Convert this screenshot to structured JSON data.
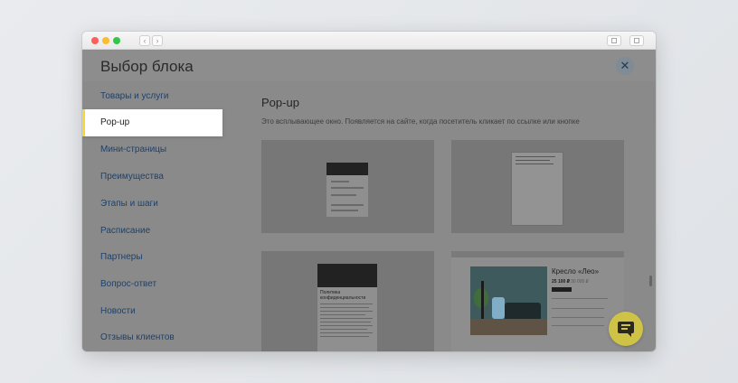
{
  "window": {
    "back": "‹",
    "forward": "›"
  },
  "header": {
    "title": "Выбор блока",
    "close": "✕"
  },
  "sidebar": {
    "items": [
      {
        "label": "Товары и услуги"
      },
      {
        "label": "Pop-up"
      },
      {
        "label": "Мини-страницы"
      },
      {
        "label": "Преимущества"
      },
      {
        "label": "Этапы и шаги"
      },
      {
        "label": "Расписание"
      },
      {
        "label": "Партнеры"
      },
      {
        "label": "Вопрос-ответ"
      },
      {
        "label": "Новости"
      },
      {
        "label": "Отзывы клиентов"
      }
    ],
    "active_index": 1
  },
  "main": {
    "title": "Pop-up",
    "description": "Это всплывающее окно. Появляется на сайте, когда посетитель кликает по ссылке или кнопке",
    "cards": [
      {
        "preview": "popup-form"
      },
      {
        "preview": "popup-text"
      },
      {
        "preview": "popup-policy",
        "preview_title": "Политика конфиденциальности"
      },
      {
        "preview": "popup-product",
        "product_title": "Кресло «Лео»",
        "price": "25 100 ₽",
        "old_price": "30 000 ₽"
      }
    ]
  },
  "colors": {
    "active_accent": "#f7d83c",
    "link": "#1f416a",
    "overlay": "#8a8a8a",
    "chat": "#cfc347"
  },
  "icons": {
    "close": "close-icon",
    "chat": "chat-icon",
    "share": "share-icon",
    "tabs": "tabs-icon"
  }
}
